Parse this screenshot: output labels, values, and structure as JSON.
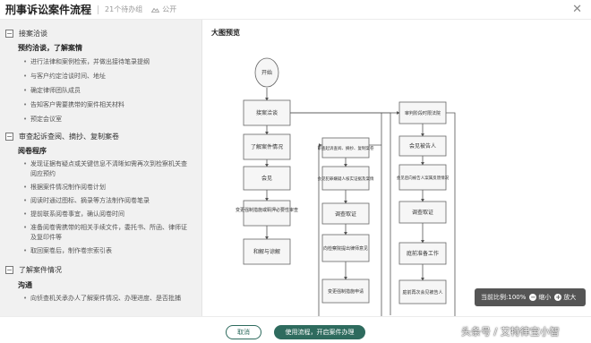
{
  "header": {
    "title": "刑事诉讼案件流程",
    "todo": "21个待办组",
    "visibility": "公开",
    "close_icon": "close-icon"
  },
  "sidebar": {
    "sections": [
      {
        "label": "接案洽谈",
        "toggle": "−",
        "subtitle": "预约洽谈，了解案情",
        "items": [
          "进行法律和案例检索，并做出接待笔录提纲",
          "与客户约定洽谈时间、地址",
          "确定律师团队成员",
          "告知客户需要携带的案件相关材料",
          "预定会议室"
        ]
      },
      {
        "label": "审查起诉查阅、摘抄、复制案卷",
        "toggle": "−",
        "subtitle": "阅卷程序",
        "items": [
          "发现证据有疑点或关键信息不清晰如需再次到检察机关查阅应预约",
          "根据案件情况制作阅卷计划",
          "阅读时通过图标、摘录等方法制作阅卷笔录",
          "提前联系阅卷事宜，确认阅卷时间",
          "准备阅卷需携带的相关手续文件，委托书、所函、律师证及复印件等",
          "取回案卷后，制作卷宗索引表"
        ]
      },
      {
        "label": "了解案件情况",
        "toggle": "−",
        "subtitle": "沟通",
        "items": [
          "向侦查机关承办人了解案件情况、办理进度、是否批捕"
        ]
      }
    ]
  },
  "preview": {
    "title": "大图预览",
    "nodes": [
      "开始",
      "接案洽谈",
      "了解案件情况",
      "会见",
      "变更强制措施或羁押必要性审查",
      "和解与谅解",
      "审查起诉查阅、摘抄、复制案卷",
      "会见犯罪嫌疑人核实证据及案情",
      "调查取证",
      "向检察院提出律师意见",
      "变更强制措施申请",
      "审判阶段时限法院",
      "会见被告人",
      "会见后向被告人案属反馈情况",
      "调查取证",
      "庭前准备工作",
      "庭前再次会见被告人"
    ]
  },
  "zoom": {
    "label": "当前比例:",
    "value": "100%",
    "shrink": "缩小",
    "enlarge": "放大"
  },
  "footer": {
    "cancel": "取消",
    "use": "使用流程，开启案件办理",
    "watermark": "头条号 / 艾特律宝小智"
  },
  "colors": {
    "accent": "#2e6b5e",
    "sidebar_bg": "#f1f1f1"
  }
}
